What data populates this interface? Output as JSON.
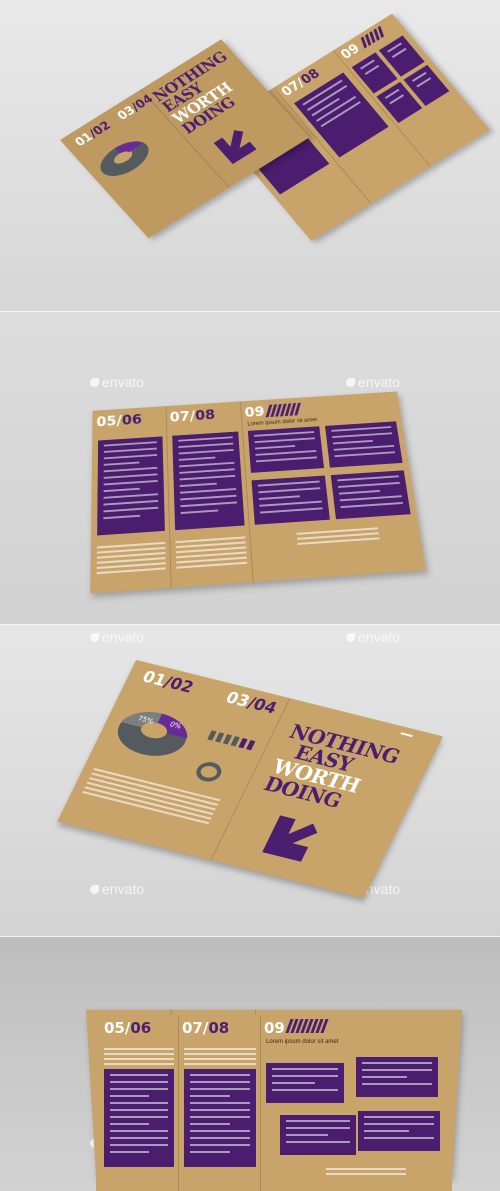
{
  "watermark": "envato",
  "brochure": {
    "headline": [
      "NOTHING",
      "EASY",
      "WORTH",
      "DOING"
    ],
    "labels": {
      "p1": {
        "a": "01",
        "sep": "/",
        "b": "02"
      },
      "p2": {
        "a": "03",
        "sep": "/",
        "b": "04"
      },
      "p3": {
        "a": "05",
        "sep": "/",
        "b": "06"
      },
      "p4": {
        "a": "07",
        "sep": "/",
        "b": "08"
      },
      "p5": {
        "a": "09"
      }
    },
    "subheading": "Lorem ipsum dolor sit amet",
    "chart_values": {
      "slice_a": "75%",
      "slice_b": "0%"
    }
  },
  "colors": {
    "kraft": "#c9a46a",
    "purple": "#4a1d6e",
    "white": "#ffffff",
    "gray": "#555a5e"
  }
}
